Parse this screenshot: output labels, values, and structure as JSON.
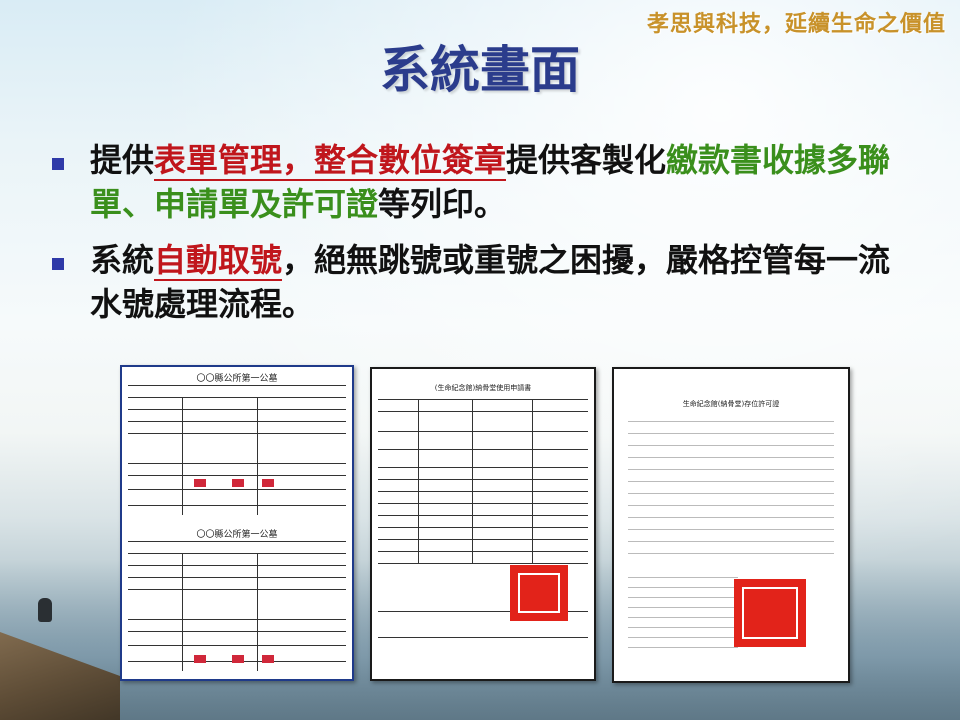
{
  "header": {
    "slogan": "孝思與科技，延續生命之價值",
    "title": "系統畫面"
  },
  "bullets": [
    {
      "parts": [
        {
          "text": "提供",
          "style": "plain"
        },
        {
          "text": "表單管理，整合數位簽章",
          "style": "red"
        },
        {
          "text": "提供客製化",
          "style": "plain"
        },
        {
          "text": "繳款書收據多聯單、申請單及許可證",
          "style": "green"
        },
        {
          "text": "等列印。",
          "style": "plain"
        }
      ]
    },
    {
      "parts": [
        {
          "text": "系統",
          "style": "plain"
        },
        {
          "text": "自動取號",
          "style": "red"
        },
        {
          "text": "，絕無跳號或重號之困擾，嚴格控管每一流水號處理流程。",
          "style": "plain"
        }
      ]
    }
  ],
  "documents": {
    "doc1": {
      "title_line1": "〇〇縣公所第一公墓",
      "title_line2": "〇〇縣公所第一公墓"
    },
    "doc2": {
      "title": "(生命紀念館)納骨堂使用申請書"
    },
    "doc3": {
      "title": "生命紀念館(納骨堂)存位許可證"
    }
  },
  "colors": {
    "title": "#2b3c8c",
    "slogan": "#c8922a",
    "red_highlight": "#c0161c",
    "green_highlight": "#3a8f1c",
    "bullet": "#2f3aa8",
    "seal": "#e2231a"
  }
}
